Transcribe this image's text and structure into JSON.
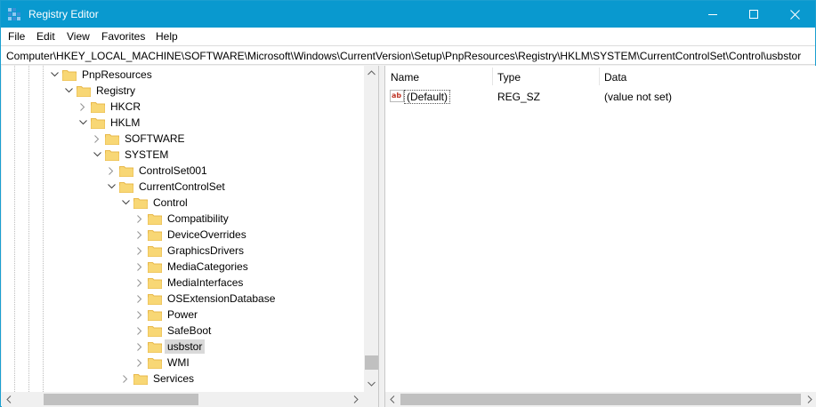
{
  "window": {
    "title": "Registry Editor",
    "controls": {
      "minimize_icon": "minimize-icon",
      "maximize_icon": "maximize-icon",
      "close_icon": "close-icon"
    }
  },
  "menu": {
    "items": [
      "File",
      "Edit",
      "View",
      "Favorites",
      "Help"
    ]
  },
  "address": {
    "path": "Computer\\HKEY_LOCAL_MACHINE\\SOFTWARE\\Microsoft\\Windows\\CurrentVersion\\Setup\\PnpResources\\Registry\\HKLM\\SYSTEM\\CurrentControlSet\\Control\\usbstor"
  },
  "tree": {
    "nodes": [
      {
        "label": "PnpResources",
        "expanded": true,
        "depth": 0
      },
      {
        "label": "Registry",
        "expanded": true,
        "depth": 1
      },
      {
        "label": "HKCR",
        "expanded": false,
        "depth": 2
      },
      {
        "label": "HKLM",
        "expanded": true,
        "depth": 2
      },
      {
        "label": "SOFTWARE",
        "expanded": false,
        "depth": 3
      },
      {
        "label": "SYSTEM",
        "expanded": true,
        "depth": 3
      },
      {
        "label": "ControlSet001",
        "expanded": false,
        "depth": 4
      },
      {
        "label": "CurrentControlSet",
        "expanded": true,
        "depth": 4
      },
      {
        "label": "Control",
        "expanded": true,
        "depth": 5
      },
      {
        "label": "Compatibility",
        "expanded": false,
        "depth": 6
      },
      {
        "label": "DeviceOverrides",
        "expanded": false,
        "depth": 6
      },
      {
        "label": "GraphicsDrivers",
        "expanded": false,
        "depth": 6
      },
      {
        "label": "MediaCategories",
        "expanded": false,
        "depth": 6
      },
      {
        "label": "MediaInterfaces",
        "expanded": false,
        "depth": 6
      },
      {
        "label": "OSExtensionDatabase",
        "expanded": false,
        "depth": 6
      },
      {
        "label": "Power",
        "expanded": false,
        "depth": 6
      },
      {
        "label": "SafeBoot",
        "expanded": false,
        "depth": 6
      },
      {
        "label": "usbstor",
        "expanded": false,
        "depth": 6,
        "selected": true
      },
      {
        "label": "WMI",
        "expanded": false,
        "depth": 6
      },
      {
        "label": "Services",
        "expanded": false,
        "depth": 5
      }
    ]
  },
  "values": {
    "columns": {
      "name": "Name",
      "type": "Type",
      "data": "Data"
    },
    "rows": [
      {
        "icon": "string-value-icon",
        "name": "(Default)",
        "type": "REG_SZ",
        "data": "(value not set)"
      }
    ]
  },
  "colors": {
    "titlebar": "#0999cf",
    "folder": "#f8d775",
    "folder_dark": "#e8b84a",
    "selection": "#d9d9d9"
  }
}
